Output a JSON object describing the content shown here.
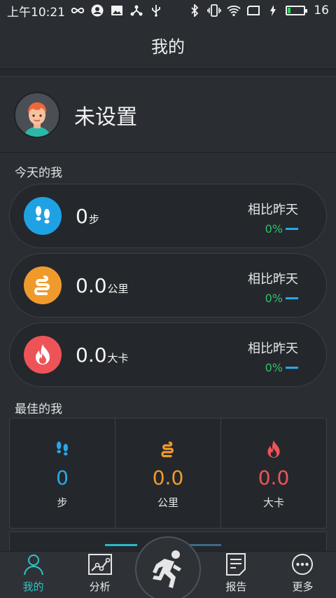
{
  "status_bar": {
    "time": "上午10:21",
    "battery": "16",
    "battery_level": 0.16
  },
  "header": {
    "title": "我的"
  },
  "profile": {
    "name": "未设置"
  },
  "today": {
    "title": "今天的我",
    "cards": [
      {
        "value": "0",
        "unit": "步",
        "compare_label": "相比昨天",
        "compare_pct": "0%",
        "color": "#1fa2e4",
        "icon": "footprints-icon"
      },
      {
        "value": "0.0",
        "unit": "公里",
        "compare_label": "相比昨天",
        "compare_pct": "0%",
        "color": "#f19a2c",
        "icon": "road-icon"
      },
      {
        "value": "0.0",
        "unit": "大卡",
        "compare_label": "相比昨天",
        "compare_pct": "0%",
        "color": "#ee5457",
        "icon": "flame-icon"
      }
    ]
  },
  "best": {
    "title": "最佳的我",
    "items": [
      {
        "value": "0",
        "label": "步",
        "color": "#2aa6e8",
        "icon": "footprints-icon"
      },
      {
        "value": "0.0",
        "label": "公里",
        "color": "#f19a2c",
        "icon": "road-icon"
      },
      {
        "value": "0.0",
        "label": "大卡",
        "color": "#ee5457",
        "icon": "flame-icon"
      }
    ]
  },
  "nav": {
    "me": "我的",
    "analysis": "分析",
    "report": "报告",
    "more": "更多",
    "accent": "#2fc4c4"
  }
}
